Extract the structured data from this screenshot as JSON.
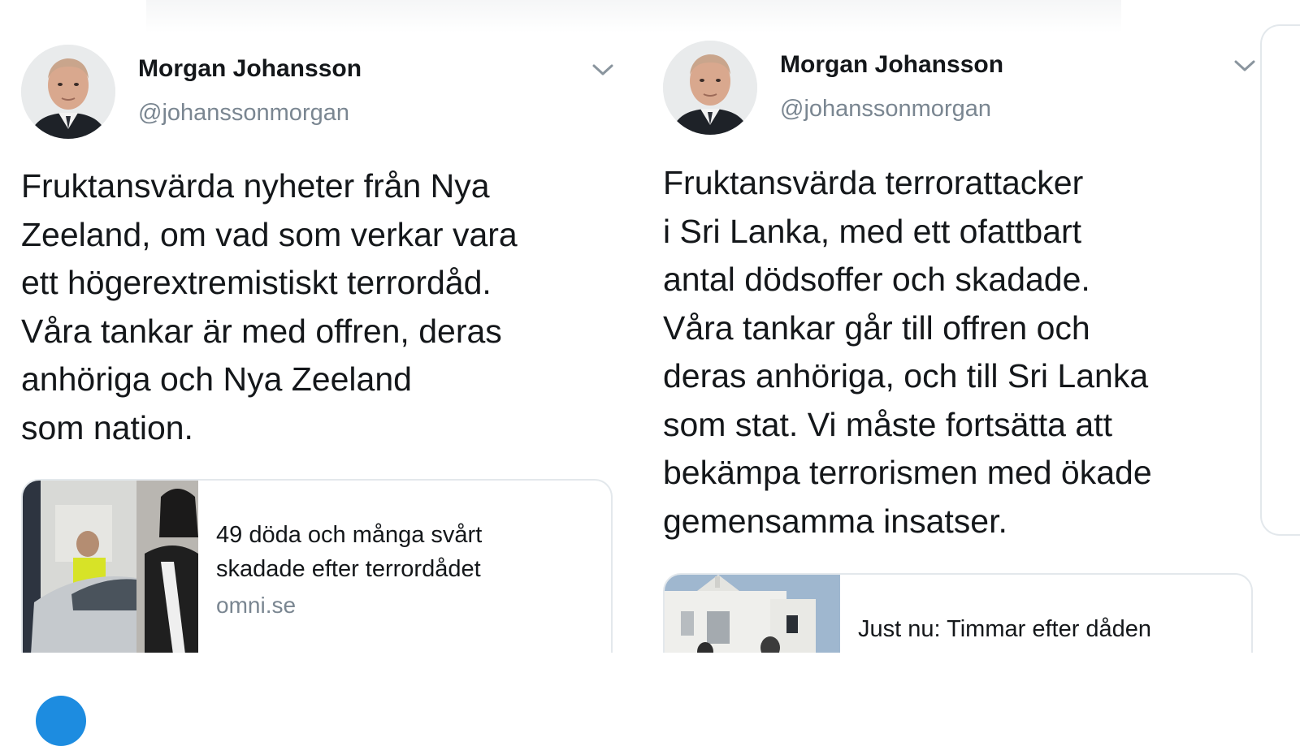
{
  "tweets": [
    {
      "author": {
        "name": "Morgan Johansson",
        "handle": "@johanssonmorgan"
      },
      "text_lines": [
        "Fruktansvärda nyheter från Nya",
        "Zeeland, om vad som verkar vara",
        "ett högerextremistiskt terrordåd.",
        "Våra tankar är med offren, deras",
        "anhöriga och Nya Zeeland",
        "som nation."
      ],
      "card": {
        "title_lines": [
          "49 döda och många svårt",
          "skadade efter terrordådet"
        ],
        "domain": "omni.se"
      }
    },
    {
      "author": {
        "name": "Morgan Johansson",
        "handle": "@johanssonmorgan"
      },
      "text_lines": [
        "Fruktansvärda terrorattacker",
        "i Sri Lanka, med ett ofattbart",
        "antal dödsoffer och skadade.",
        "Våra tankar går till offren och",
        "deras anhöriga, och till Sri Lanka",
        "som stat. Vi måste fortsätta att",
        "bekämpa terrorismen med ökade",
        "gemensamma insatser."
      ],
      "card": {
        "title_lines": [
          "Just nu: Timmar efter dåden"
        ]
      }
    }
  ],
  "icons": {
    "menu": "chevron-down-icon",
    "avatar": "avatar"
  },
  "colors": {
    "text": "#14171a",
    "secondary": "#7a8691",
    "border": "#e3e8ec",
    "accent": "#1d8ce0"
  }
}
